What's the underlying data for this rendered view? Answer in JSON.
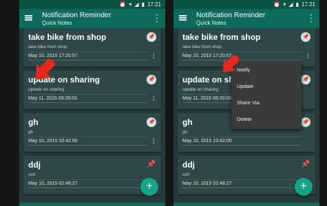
{
  "status_bar": {
    "time": "17:21"
  },
  "toolbar": {
    "title": "Notification Reminder",
    "subtitle": "Quick Notes"
  },
  "notes": [
    {
      "title": "take bike from shop",
      "body": "take bike from shop",
      "date": "May 10, 2015 17:20:57",
      "pinned": true
    },
    {
      "title": "update on sharing",
      "body": "update on sharing",
      "date": "May 11, 2015 09:20:00",
      "pinned": true
    },
    {
      "title": "gh",
      "body": "gh",
      "date": "May 10, 2015 10:42:00",
      "pinned": true
    },
    {
      "title": "ddj",
      "body": "xxh",
      "date": "May 10, 2015 02:48:27",
      "pinned": false
    }
  ],
  "popup_menu": {
    "items": [
      "Notify",
      "Update",
      "Share Via",
      "Delete"
    ]
  },
  "fab": {
    "label": "+"
  },
  "colors": {
    "accent": "#13a58c",
    "toolbar": "#0e6b5b",
    "status_bar": "#0d5246",
    "background": "#263b3b",
    "card": "#304747",
    "arrow": "#e8281c",
    "popup": "#3a3a3a"
  },
  "icons": [
    "menu-icon",
    "overflow-icon",
    "pin-icon",
    "add-icon",
    "alarm-icon",
    "wifi-icon",
    "signal-icon",
    "battery-icon"
  ]
}
